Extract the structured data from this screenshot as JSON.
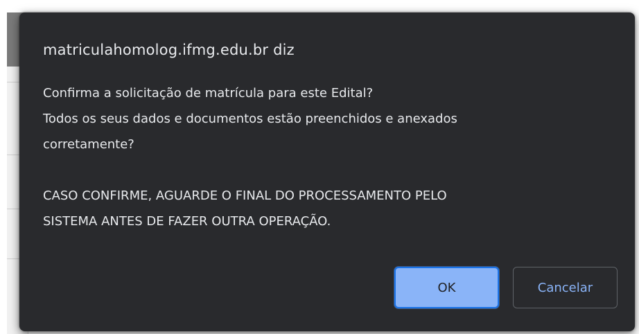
{
  "dialog": {
    "title": "matriculahomolog.ifmg.edu.br diz",
    "message_lines": [
      "Confirma a solicitação de matrícula para este Edital?",
      "Todos os seus dados e documentos estão preenchidos e anexados",
      "corretamente?",
      "",
      "CASO CONFIRME, AGUARDE O FINAL DO PROCESSAMENTO PELO",
      "SISTEMA ANTES DE FAZER OUTRA OPERAÇÃO."
    ],
    "ok_label": "OK",
    "cancel_label": "Cancelar"
  },
  "colors": {
    "dialog_background": "#292a2d",
    "text": "#e8eaed",
    "primary_button": "#8ab4f8",
    "primary_border": "#1a73e8",
    "cancel_text": "#8ab4f8"
  }
}
